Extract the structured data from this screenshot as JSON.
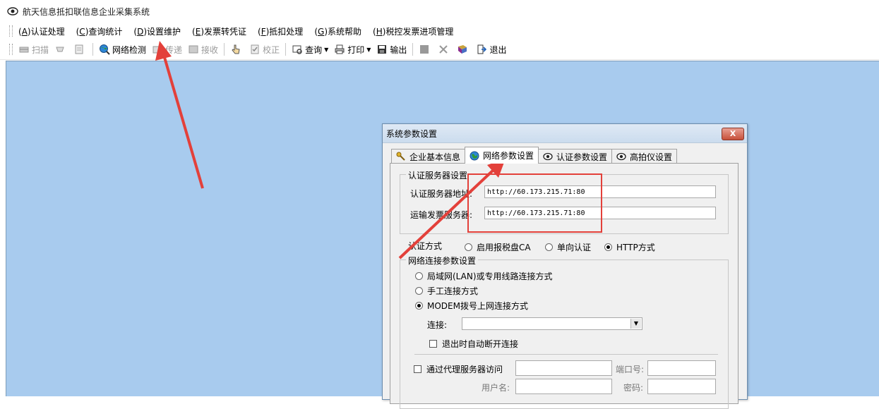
{
  "window": {
    "title": "航天信息抵扣联信息企业采集系统"
  },
  "menu": [
    {
      "key": "A",
      "text": "认证处理"
    },
    {
      "key": "C",
      "text": "查询统计"
    },
    {
      "key": "D",
      "text": "设置维护"
    },
    {
      "key": "E",
      "text": "发票转凭证"
    },
    {
      "key": "F",
      "text": "抵扣处理"
    },
    {
      "key": "G",
      "text": "系统帮助"
    },
    {
      "key": "H",
      "text": "税控发票进项管理"
    }
  ],
  "toolbar": {
    "scan": "扫描",
    "network_check": "网络检测",
    "send": "传递",
    "receive": "接收",
    "calibrate": "校正",
    "query": "查询",
    "print": "打印",
    "export": "输出",
    "exit": "退出"
  },
  "dialog": {
    "title": "系统参数设置",
    "close": "X",
    "tabs": [
      "企业基本信息",
      "网络参数设置",
      "认证参数设置",
      "高拍仪设置"
    ],
    "server_group": {
      "title": "认证服务器设置",
      "auth_server_label": "认证服务器地址:",
      "auth_server_value": "http://60.173.215.71:80",
      "transport_server_label": "运输发票服务器:",
      "transport_server_value": "http://60.173.215.71:80"
    },
    "auth_method": {
      "label": "认证方式",
      "options": [
        "启用报税盘CA",
        "单向认证",
        "HTTP方式"
      ],
      "selected": "HTTP方式"
    },
    "network_group": {
      "title": "网络连接参数设置",
      "options": [
        "局域网(LAN)或专用线路连接方式",
        "手工连接方式",
        "MODEM拨号上网连接方式"
      ],
      "selected": "MODEM拨号上网连接方式",
      "connection_label": "连接:",
      "connection_value": "",
      "auto_disconnect": "退出时自动断开连接",
      "proxy_label": "通过代理服务器访问",
      "port_label": "端口号:",
      "username_label": "用户名:",
      "password_label": "密码:"
    }
  },
  "colors": {
    "workspace": "#a8cbee",
    "annotation": "#e3403a"
  }
}
